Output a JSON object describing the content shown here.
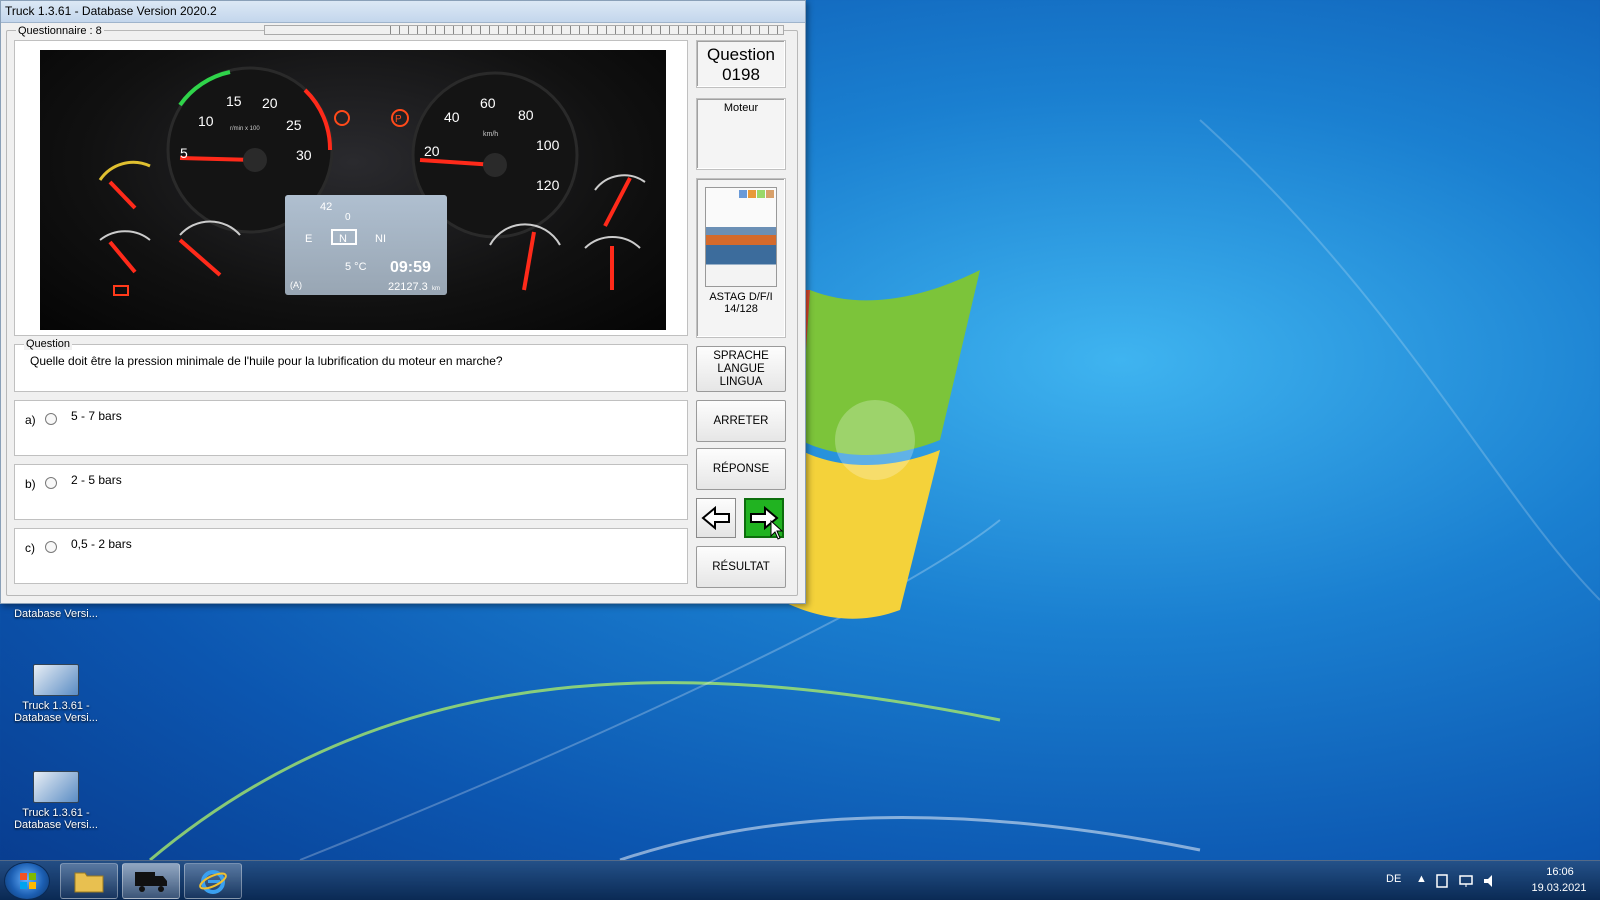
{
  "window": {
    "title": "Truck 1.3.61 - Database Version 2020.2",
    "questionnaire_label": "Questionnaire : 8"
  },
  "question_panel": {
    "heading": "Question",
    "number": "0198",
    "category": "Moteur",
    "book_title": "ASTAG D/F/I",
    "book_page": "14/128"
  },
  "dashboard_image": {
    "rpm_ticks": [
      "5",
      "10",
      "15",
      "20",
      "25",
      "30"
    ],
    "rpm_unit": "r/min x 100",
    "speed_ticks": [
      "20",
      "40",
      "60",
      "80",
      "100",
      "120"
    ],
    "speed_unit": "km/h",
    "display_fuel": "42",
    "display_fuel2": "0",
    "display_gear": [
      "E",
      "N",
      "NI"
    ],
    "display_temp": "5 °C",
    "display_time": "09:59",
    "display_odometer": "22127.3",
    "display_odometer_unit": "km",
    "display_mode": "(A)"
  },
  "question": {
    "legend": "Question",
    "text": "Quelle doit être la pression minimale de l'huile pour la lubrification du moteur en marche?"
  },
  "answers": [
    {
      "letter": "a)",
      "text": "5 - 7 bars"
    },
    {
      "letter": "b)",
      "text": "2 - 5 bars"
    },
    {
      "letter": "c)",
      "text": "0,5 - 2 bars"
    }
  ],
  "buttons": {
    "language": [
      "SPRACHE",
      "LANGUE",
      "LINGUA"
    ],
    "stop": "ARRETER",
    "answer": "RÉPONSE",
    "result": "RÉSULTAT"
  },
  "desktop_icons": [
    {
      "label1": "Database Versi..."
    },
    {
      "label1": "Truck 1.3.61 -",
      "label2": "Database Versi..."
    },
    {
      "label1": "Truck 1.3.61 -",
      "label2": "Database Versi..."
    }
  ],
  "taskbar": {
    "language": "DE",
    "time": "16:06",
    "date": "19.03.2021"
  },
  "colors": {
    "next_button": "#21b321",
    "gauge_needle": "#ff2a1a",
    "display_bg": "#c8d4e0"
  }
}
